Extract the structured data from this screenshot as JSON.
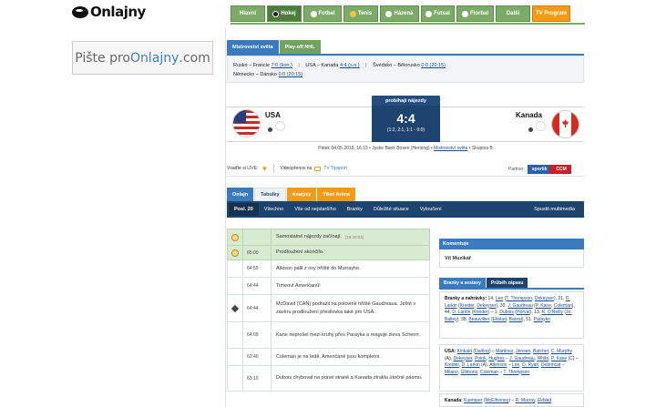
{
  "logo": {
    "text": "Onlajny"
  },
  "nav": {
    "items": [
      {
        "label": "Hlavní",
        "icon": ""
      },
      {
        "label": "Hokej",
        "icon": "hockey-icon",
        "active": true
      },
      {
        "label": "Fotbal",
        "icon": "football-icon"
      },
      {
        "label": "Tenis",
        "icon": "tennis-icon"
      },
      {
        "label": "Házená",
        "icon": "handball-icon"
      },
      {
        "label": "Futsal",
        "icon": "futsal-icon"
      },
      {
        "label": "Florbal",
        "icon": "floorball-icon"
      },
      {
        "label": "Další",
        "icon": ""
      },
      {
        "label": "TV Program",
        "icon": ""
      }
    ]
  },
  "banner": {
    "prefix": "Pište pro ",
    "brand": "Onlajny",
    "suffix": ".com"
  },
  "competition": {
    "tabs": [
      "Mistrovství světa",
      "Play-off NHL"
    ],
    "results": {
      "r1": {
        "t": "Rusko – Francie",
        "s": "7:0 (kon.)"
      },
      "r2": {
        "t": "USA – Kanada",
        "s": "4:4 (s.n.)"
      },
      "r3": {
        "t": "Švédsko – Bělorusko",
        "s": "0:0 (20:15)"
      },
      "r4": {
        "t": "Německo – Dánsko",
        "s": "0:0 (20:15)"
      }
    }
  },
  "match": {
    "home": "USA",
    "away": "Kanada",
    "status": "probíhají nájezdy",
    "score": "4:4",
    "periods": "(1:2, 2:1, 1:1 - 0:0)",
    "info_prefix": "Pátek 04.05.2018, 16:15 • Jyske Bank Boxen (Herning) • ",
    "info_link": "Mistrovství světa",
    "info_suffix": " • Skupina B"
  },
  "live": {
    "label": "Vsaďte si LIVE:",
    "video": "Videopřenos na",
    "tv": "TV Tipsport",
    "partner": "Partner:",
    "partner_logo_left": "sportik",
    "partner_logo_right": "CCM"
  },
  "tabs": [
    "Onlajn",
    "Tabulky",
    "Analýzy",
    "Tiket Aréna"
  ],
  "subtabs": [
    "Posl. 20",
    "Všechno",
    "Vše od nejstaršího",
    "Branky",
    "Důležité situace",
    "Vyloučení",
    "Spustit multimedia"
  ],
  "feed": [
    {
      "time": "",
      "text": "Samostatné nájezdy začínají.",
      "ts": "(18:49:52)",
      "icon": "clock",
      "hl": true
    },
    {
      "time": "65:00",
      "text": "Prodloužení skončilo.",
      "ts": "",
      "icon": "clock",
      "hl": true
    },
    {
      "time": "64:55",
      "text": "Atkison pálil z osy hřiště do Murrayho.",
      "ts": "",
      "icon": "",
      "hl": false
    },
    {
      "time": "64:44",
      "text": "Timeout Američanů!",
      "ts": "",
      "icon": "",
      "hl": false
    },
    {
      "time": "64:44",
      "text": "McDavid (CAN) podrazil na polovině hřiště Gaudreaua. Ještě v závěru prodloužení přesilovka také pro USA.",
      "ts": "",
      "icon": "stick",
      "hl": false
    },
    {
      "time": "64:09",
      "text": "Kane neprošel mezi kruhy přes Parayka a reaguje zleva Schenn.",
      "ts": "",
      "icon": "",
      "hl": false
    },
    {
      "time": "63:40",
      "text": "Coleman je na ledě, Američané jsou kompletní.",
      "ts": "",
      "icon": "",
      "hl": false
    },
    {
      "time": "63:10",
      "text": "Dubois chyboval na pravé straně a Kanada ztratila útočné pásmo.",
      "ts": "",
      "icon": "",
      "hl": false
    }
  ],
  "comments": {
    "title": "Komentuje",
    "author": "Vít Muzikář"
  },
  "right_tabs": [
    "Branky a sestavy",
    "Průběh zápasu"
  ],
  "lineups": {
    "goals": {
      "label": "Branky a nahrávky:",
      "p1": " 14. ",
      "l1": "Lee",
      "p2": " (",
      "l2": "T. Thompson",
      "p3": ", ",
      "l3": "Dekeyser",
      "p4": "), 21. ",
      "l4": "D. Larkin",
      "p5": " (",
      "l5": "Kreider",
      "p6": ", ",
      "l6": "Dekeyser",
      "p7": "), 30. ",
      "l7": "J. Gaudreau",
      "p8": " (",
      "l8": "P. Kane",
      "p9": ", ",
      "l9": "Coleman",
      "p10": "), 44. ",
      "l10": "D. Larkin",
      "p11": " (",
      "l11": "Kreider",
      "p12": ") – 1. ",
      "l12": "Dubois",
      "p13": " (",
      "l13": "Horvat",
      "p14": "), 13. ",
      "l14": "R. O'Reilly",
      "p15": " (",
      "l15": "Jo. Bailey",
      "p16": "), 38. ",
      "l16": "Beauvillier",
      "p17": " (",
      "l17": "Ekblad",
      "p18": ", ",
      "l18": "Barzal",
      "p19": "), 51. ",
      "l19": "Parayko"
    },
    "usa": {
      "label": "USA:",
      "p1": " ",
      "l1": "Kinkaid",
      "p2": " (",
      "l2": "Darling",
      "p3": ") – ",
      "l3": "Martinez",
      "p4": ", ",
      "l4": "Jensen",
      "p5": ", ",
      "l5": "Butcher",
      "p6": ", ",
      "l6": "C. Murphy",
      "p7": " (A), ",
      "l7": "Dekeyser",
      "p8": ", ",
      "l8": "Poink",
      "p9": ", ",
      "l9": "Hughes",
      "p10": " – ",
      "l10": "J. Gaudreau",
      "p11": ", ",
      "l11": "White",
      "p12": ", ",
      "l12": "P. Kane",
      "p13": " (C) – ",
      "l13": "Kreider",
      "p14": ", ",
      "l14": "D. Larkin",
      "p15": " (A), ",
      "l15": "Atkinson",
      "p16": " – ",
      "l16": "Lee",
      "p17": ", ",
      "l17": "D. Ryan",
      "p18": ", ",
      "l18": "Debrincat",
      "p19": " – ",
      "l19": "Milano",
      "p20": ", ",
      "l20": "Gibbons",
      "p21": ", ",
      "l21": "Coleman",
      "p22": " – ",
      "l22": "T. Thompson"
    },
    "can": {
      "label": "Kanada:",
      "p1": " ",
      "l1": "Kuemper",
      "p2": " (",
      "l2": "McElhinney",
      "p3": ") – ",
      "l3": "R. Murray",
      "p4": ", ",
      "l4": "Ekblad"
    }
  }
}
